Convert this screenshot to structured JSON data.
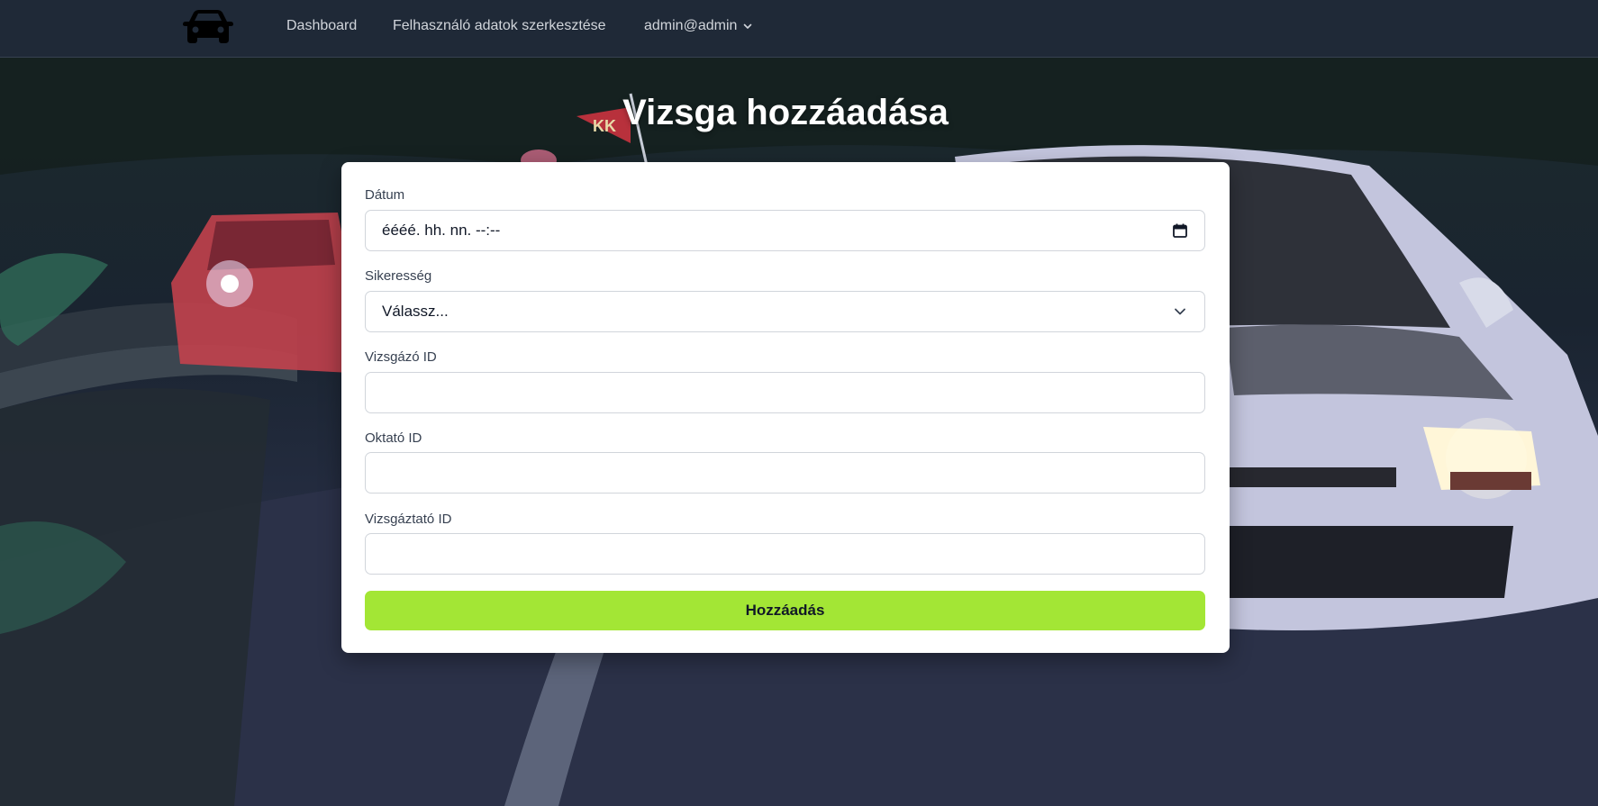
{
  "navbar": {
    "logo_icon": "car-front-icon",
    "links": [
      {
        "label": "Dashboard"
      },
      {
        "label": "Felhasználó adatok szerkesztése"
      }
    ],
    "user_menu": {
      "label": "admin@admin",
      "icon": "chevron-down-icon"
    }
  },
  "page": {
    "title": "Vizsga hozzáadása"
  },
  "form": {
    "datum": {
      "label": "Dátum",
      "value": "éééé. hh. nn. --:--",
      "icon": "calendar-icon"
    },
    "sikeresseg": {
      "label": "Sikeresség",
      "value": "Válassz...",
      "icon": "chevron-down-icon"
    },
    "vizsgazo_id": {
      "label": "Vizsgázó ID",
      "value": ""
    },
    "oktato_id": {
      "label": "Oktató ID",
      "value": ""
    },
    "vizsgaztato_id": {
      "label": "Vizsgáztató ID",
      "value": ""
    },
    "submit_label": "Hozzáadás"
  },
  "colors": {
    "navbar_bg": "#1f2937",
    "accent": "#a3e635",
    "card_bg": "#ffffff"
  },
  "background": {
    "flag_text": "KK"
  }
}
